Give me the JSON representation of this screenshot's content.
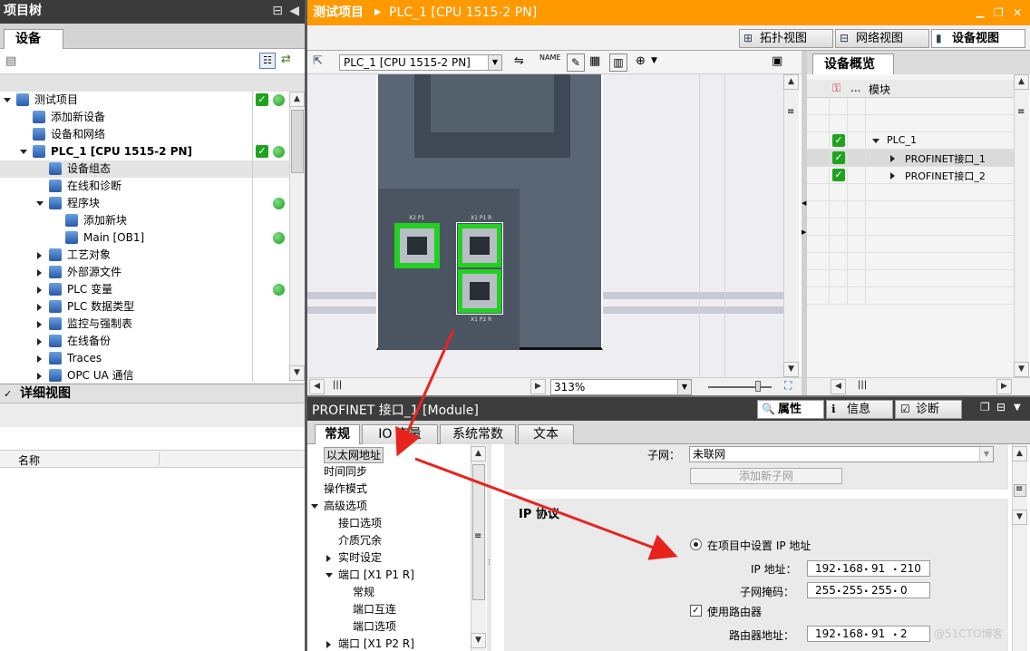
{
  "left_panel": {
    "title": "项目树",
    "tab": "设备",
    "tree": [
      {
        "label": "测试项目",
        "indent": 0,
        "expand": "down",
        "check": true,
        "dot": true
      },
      {
        "label": "添加新设备",
        "indent": 1,
        "expand": "",
        "check": false,
        "dot": false
      },
      {
        "label": "设备和网络",
        "indent": 1,
        "expand": "",
        "check": false,
        "dot": false
      },
      {
        "label": "PLC_1 [CPU 1515-2 PN]",
        "indent": 1,
        "expand": "down",
        "check": true,
        "dot": true
      },
      {
        "label": "设备组态",
        "indent": 2,
        "expand": "",
        "check": false,
        "dot": false,
        "selected": true
      },
      {
        "label": "在线和诊断",
        "indent": 2,
        "expand": "",
        "check": false,
        "dot": false
      },
      {
        "label": "程序块",
        "indent": 2,
        "expand": "down",
        "check": false,
        "dot": true
      },
      {
        "label": "添加新块",
        "indent": 3,
        "expand": "",
        "check": false,
        "dot": false
      },
      {
        "label": "Main [OB1]",
        "indent": 3,
        "expand": "",
        "check": false,
        "dot": true
      },
      {
        "label": "工艺对象",
        "indent": 2,
        "expand": "right",
        "check": false,
        "dot": false
      },
      {
        "label": "外部源文件",
        "indent": 2,
        "expand": "right",
        "check": false,
        "dot": false
      },
      {
        "label": "PLC 变量",
        "indent": 2,
        "expand": "right",
        "check": false,
        "dot": true
      },
      {
        "label": "PLC 数据类型",
        "indent": 2,
        "expand": "right",
        "check": false,
        "dot": false
      },
      {
        "label": "监控与强制表",
        "indent": 2,
        "expand": "right",
        "check": false,
        "dot": false
      },
      {
        "label": "在线备份",
        "indent": 2,
        "expand": "right",
        "check": false,
        "dot": false
      },
      {
        "label": "Traces",
        "indent": 2,
        "expand": "right",
        "check": false,
        "dot": false
      },
      {
        "label": "OPC UA 通信",
        "indent": 2,
        "expand": "right",
        "check": false,
        "dot": false
      }
    ],
    "detail_title": "详细视图",
    "detail_col": "名称"
  },
  "main": {
    "title": "测试项目",
    "breadcrumb": "PLC_1 [CPU 1515-2 PN]",
    "views": {
      "topology": "拓扑视图",
      "network": "网络视图",
      "device": "设备视图"
    },
    "device_select": "PLC_1 [CPU 1515-2 PN]",
    "zoom": "313%",
    "port_labels": {
      "x2p1": "X2 P1",
      "x1p1": "X1 P1 R",
      "x1p2": "X1 P2 R"
    }
  },
  "overview": {
    "tab": "设备概览",
    "col_module": "模块",
    "col_dots": "...",
    "rows": [
      {
        "label": "",
        "check": false,
        "expand": ""
      },
      {
        "label": "",
        "check": false,
        "expand": ""
      },
      {
        "label": "PLC_1",
        "check": true,
        "expand": "down"
      },
      {
        "label": "PROFINET接口_1",
        "check": true,
        "expand": "right"
      },
      {
        "label": "PROFINET接口_2",
        "check": true,
        "expand": "right"
      }
    ]
  },
  "inspector": {
    "title": "PROFINET 接口_1 [Module]",
    "right_tabs": {
      "properties": "属性",
      "info": "信息",
      "diag": "诊断"
    },
    "tabs": [
      "常规",
      "IO 变量",
      "系统常数",
      "文本"
    ],
    "nav": [
      {
        "label": "以太网地址",
        "indent": 0,
        "expand": "",
        "selected": true
      },
      {
        "label": "时间同步",
        "indent": 0,
        "expand": ""
      },
      {
        "label": "操作模式",
        "indent": 0,
        "expand": ""
      },
      {
        "label": "高级选项",
        "indent": 0,
        "expand": "down"
      },
      {
        "label": "接口选项",
        "indent": 1,
        "expand": ""
      },
      {
        "label": "介质冗余",
        "indent": 1,
        "expand": ""
      },
      {
        "label": "实时设定",
        "indent": 1,
        "expand": "right"
      },
      {
        "label": "端口 [X1 P1 R]",
        "indent": 1,
        "expand": "down"
      },
      {
        "label": "常规",
        "indent": 2,
        "expand": ""
      },
      {
        "label": "端口互连",
        "indent": 2,
        "expand": ""
      },
      {
        "label": "端口选项",
        "indent": 2,
        "expand": ""
      },
      {
        "label": "端口 [X1 P2 R]",
        "indent": 1,
        "expand": "right"
      }
    ],
    "subnet_label": "子网：",
    "subnet_value": "未联网",
    "add_subnet": "添加新子网",
    "ip_section": "IP 协议",
    "radio_label": "在项目中设置 IP 地址",
    "ip_label": "IP 地址：",
    "ip": [
      "192",
      "168",
      "91",
      "210"
    ],
    "mask_label": "子网掩码：",
    "mask": [
      "255",
      "255",
      "255",
      "0"
    ],
    "router_check": "使用路由器",
    "router_label": "路由器地址：",
    "router": [
      "192",
      "168",
      "91",
      "2"
    ],
    "watermark": "@51CTO博客"
  },
  "colors": {
    "accent_orange": "#ff9900",
    "dark_bar": "#3b3b3b",
    "port_green": "#22d122",
    "arrow_red": "#e8231e"
  }
}
